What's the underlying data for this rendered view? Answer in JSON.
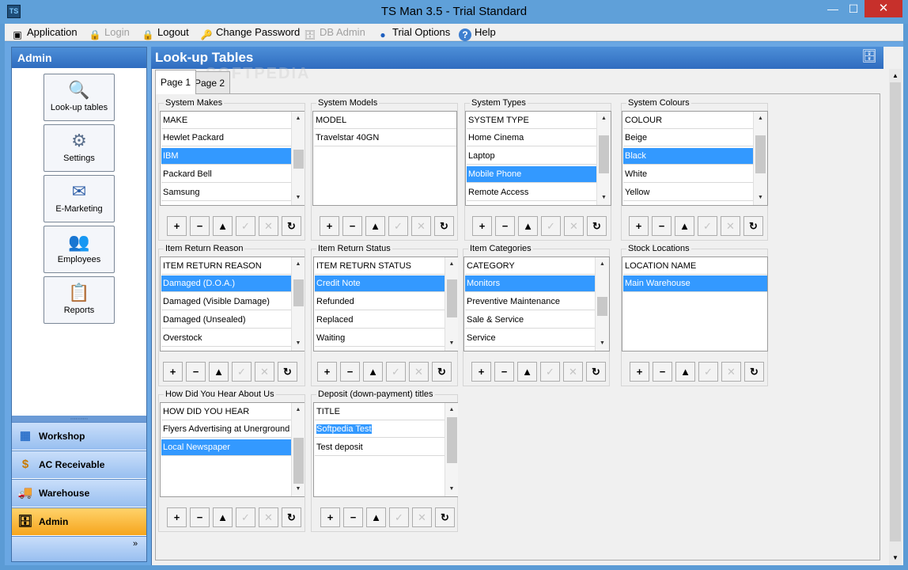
{
  "window": {
    "app_icon": "TS",
    "title": "TS Man 3.5 - Trial Standard",
    "min": "—",
    "max": "☐",
    "close": "✕"
  },
  "menu": [
    {
      "label": "Application",
      "icon": "▣",
      "enabled": true
    },
    {
      "label": "Login",
      "icon": "🔒",
      "enabled": false
    },
    {
      "label": "Logout",
      "icon": "🔒",
      "enabled": true
    },
    {
      "label": "Change Password",
      "icon": "🔑",
      "enabled": true
    },
    {
      "label": "DB Admin",
      "icon": "🗄",
      "enabled": false
    },
    {
      "label": "Trial Options",
      "icon": "●",
      "enabled": true
    },
    {
      "label": "Help",
      "icon": "?",
      "enabled": true
    }
  ],
  "sidebar": {
    "header": "Admin",
    "buttons": [
      {
        "label": "Look-up tables",
        "icon": "🔍"
      },
      {
        "label": "Settings",
        "icon": "⚙"
      },
      {
        "label": "E-Marketing",
        "icon": "✉"
      },
      {
        "label": "Employees",
        "icon": "👥"
      },
      {
        "label": "Reports",
        "icon": "📋"
      }
    ],
    "sections": [
      {
        "label": "Workshop",
        "icon": "▦"
      },
      {
        "label": "AC Receivable",
        "icon": "$"
      },
      {
        "label": "Warehouse",
        "icon": "🚚"
      },
      {
        "label": "Admin",
        "icon": "🗄"
      }
    ],
    "more": "»"
  },
  "main": {
    "title": "Look-up Tables",
    "header_icon": "🗄",
    "watermark": "SOFTPEDIA",
    "tabs": [
      "Page 1",
      "Page 2"
    ]
  },
  "toolbar": {
    "add": "+",
    "remove": "−",
    "up": "▲",
    "edit": "✓",
    "cancel": "✕",
    "refresh": "↻"
  },
  "scroll": {
    "up": "▲",
    "down": "▼"
  },
  "lists": {
    "system_makes": {
      "title": "System Makes",
      "header": "MAKE",
      "rows": [
        "Hewlet Packard",
        "IBM",
        "Packard Bell",
        "Samsung"
      ],
      "selected": "IBM"
    },
    "system_models": {
      "title": "System Models",
      "header": "MODEL",
      "rows": [
        "Travelstar 40GN"
      ]
    },
    "system_types": {
      "title": "System Types",
      "header": "SYSTEM TYPE",
      "rows": [
        "Home Cinema",
        "Laptop",
        "Mobile Phone",
        "Remote Access"
      ],
      "selected": "Mobile Phone"
    },
    "system_colours": {
      "title": "System Colours",
      "header": "COLOUR",
      "rows": [
        "Beige",
        "Black",
        "White",
        "Yellow"
      ],
      "selected": "Black"
    },
    "item_return_reason": {
      "title": "Item Return Reason",
      "header": "ITEM RETURN REASON",
      "rows": [
        "Damaged (D.O.A.)",
        "Damaged (Visible Damage)",
        "Damaged (Unsealed)",
        "Overstock"
      ],
      "selected": "Damaged (D.O.A.)"
    },
    "item_return_status": {
      "title": "Item Return Status",
      "header": "ITEM RETURN STATUS",
      "rows": [
        "Credit Note",
        "Refunded",
        "Replaced",
        "Waiting"
      ],
      "selected": "Credit Note"
    },
    "item_categories": {
      "title": "Item Categories",
      "header": "CATEGORY",
      "rows": [
        "Monitors",
        "Preventive Maintenance",
        "Sale & Service",
        "Service"
      ],
      "selected": "Monitors"
    },
    "stock_locations": {
      "title": "Stock Locations",
      "header": "LOCATION NAME",
      "rows": [
        "Main Warehouse"
      ],
      "selected": "Main Warehouse"
    },
    "how_did_you_hear": {
      "title": "How Did You Hear About Us",
      "header": "HOW DID YOU HEAR",
      "rows": [
        "Flyers Advertising at Unerground",
        "Local Newspaper"
      ],
      "selected": "Local Newspaper"
    },
    "deposit_titles": {
      "title": "Deposit (down-payment) titles",
      "header": "TITLE",
      "rows": [
        "Softpedia Test",
        "Test deposit"
      ],
      "selected": "Softpedia Test"
    }
  }
}
